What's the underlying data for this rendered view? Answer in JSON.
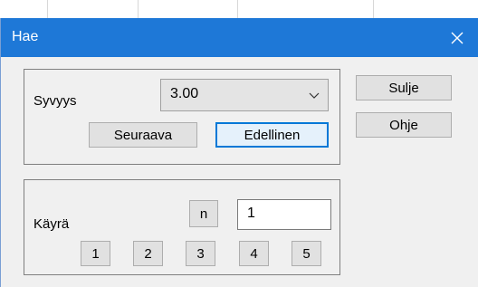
{
  "window": {
    "title": "Hae",
    "close_symbol": "✕"
  },
  "search": {
    "depth_label": "Syvyys",
    "depth_value": "3.00",
    "next_label": "Seuraava",
    "previous_label": "Edellinen"
  },
  "curve": {
    "label": "Käyrä",
    "n_label": "n",
    "n_value": "1",
    "number_buttons": [
      "1",
      "2",
      "3",
      "4",
      "5"
    ]
  },
  "actions": {
    "close_label": "Sulje",
    "help_label": "Ohje"
  },
  "colors": {
    "titlebar": "#1e78d7",
    "default_button_border": "#0078d7"
  },
  "icons": {
    "close": "close-icon",
    "dropdown": "chevron-down-icon"
  }
}
